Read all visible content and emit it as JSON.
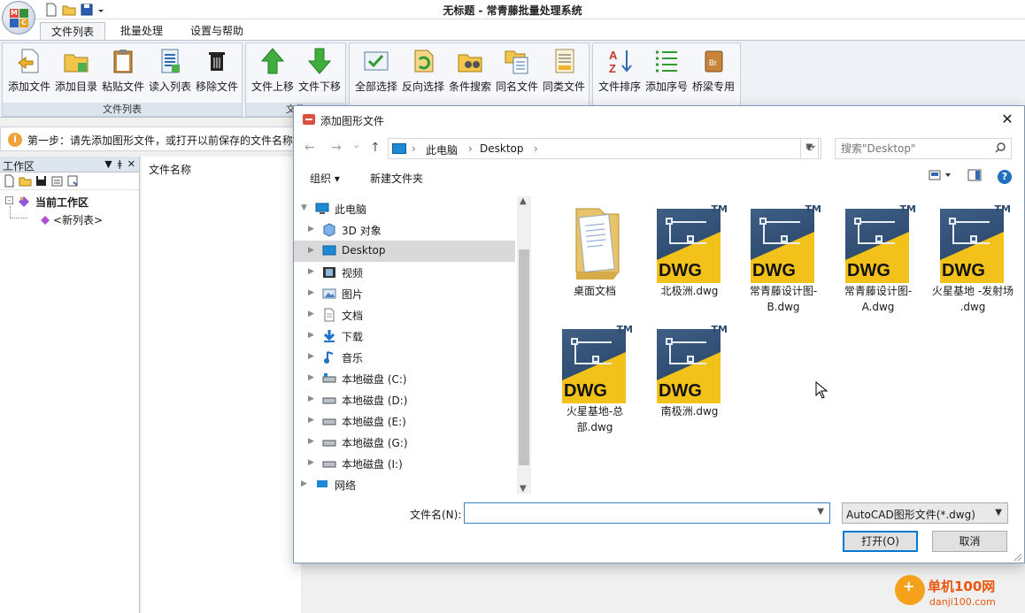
{
  "window": {
    "title": "无标题 - 常青藤批量处理系统",
    "quick_access_icons": [
      "new-file-icon",
      "open-folder-icon",
      "save-icon",
      "dropdown-arrow-icon"
    ]
  },
  "ribbon": {
    "tabs": [
      {
        "label": "文件列表",
        "active": true
      },
      {
        "label": "批量处理",
        "active": false
      },
      {
        "label": "设置与帮助",
        "active": false
      }
    ],
    "groups": [
      {
        "caption": "文件列表",
        "buttons": [
          "添加文件",
          "添加目录",
          "粘贴文件",
          "读入列表",
          "移除文件"
        ]
      },
      {
        "caption": "文件",
        "buttons": [
          "文件上移",
          "文件下移"
        ]
      },
      {
        "caption": "",
        "buttons": [
          "全部选择",
          "反向选择",
          "条件搜索",
          "同名文件",
          "同类文件"
        ]
      },
      {
        "caption": "",
        "buttons": [
          "文件排序",
          "添加序号",
          "桥梁专用"
        ]
      }
    ]
  },
  "hint": {
    "text": "第一步：请先添加图形文件，或打开以前保存的文件名称"
  },
  "workspace": {
    "title": "工作区",
    "controls": [
      "▼",
      "ǂ",
      "✕"
    ],
    "tree": {
      "root": "当前工作区",
      "child": "<新列表>"
    }
  },
  "file_list": {
    "column_header": "文件名称"
  },
  "dialog": {
    "title": "添加图形文件",
    "close": "✕",
    "nav": {
      "back": "←",
      "forward": "→",
      "recent": "⌄",
      "up": "↑"
    },
    "address": {
      "segments": [
        "此电脑",
        "Desktop"
      ],
      "separator": "›"
    },
    "search": {
      "placeholder": "搜索\"Desktop\""
    },
    "commands": {
      "organize": "组织 ▾",
      "new_folder": "新建文件夹"
    },
    "nav_tree": [
      {
        "label": "此电脑",
        "icon": "pc-icon",
        "expanded": true,
        "level": 0,
        "selected": false
      },
      {
        "label": "3D 对象",
        "icon": "3d-objects-icon",
        "level": 1,
        "selected": false
      },
      {
        "label": "Desktop",
        "icon": "desktop-icon",
        "level": 1,
        "selected": true
      },
      {
        "label": "视频",
        "icon": "video-icon",
        "level": 1,
        "selected": false
      },
      {
        "label": "图片",
        "icon": "pictures-icon",
        "level": 1,
        "selected": false
      },
      {
        "label": "文档",
        "icon": "documents-icon",
        "level": 1,
        "selected": false
      },
      {
        "label": "下载",
        "icon": "download-icon",
        "level": 1,
        "selected": false
      },
      {
        "label": "音乐",
        "icon": "music-icon",
        "level": 1,
        "selected": false
      },
      {
        "label": "本地磁盘 (C:)",
        "icon": "drive-icon",
        "level": 1,
        "selected": false
      },
      {
        "label": "本地磁盘 (D:)",
        "icon": "drive-icon",
        "level": 1,
        "selected": false
      },
      {
        "label": "本地磁盘 (E:)",
        "icon": "drive-icon",
        "level": 1,
        "selected": false
      },
      {
        "label": "本地磁盘 (G:)",
        "icon": "drive-icon",
        "level": 1,
        "selected": false
      },
      {
        "label": "本地磁盘 (I:)",
        "icon": "drive-icon",
        "level": 1,
        "selected": false
      },
      {
        "label": "网络",
        "icon": "network-icon",
        "level": 0,
        "selected": false
      }
    ],
    "files": [
      {
        "name": "桌面文档",
        "type": "folder"
      },
      {
        "name": "北极洲.dwg",
        "type": "dwg"
      },
      {
        "name": "常青藤设计图-B.dwg",
        "type": "dwg"
      },
      {
        "name": "常青藤设计图-A.dwg",
        "type": "dwg"
      },
      {
        "name": "火星基地 -发射场 .dwg",
        "type": "dwg"
      },
      {
        "name": "火星基地-总部.dwg",
        "type": "dwg"
      },
      {
        "name": "南极洲.dwg",
        "type": "dwg"
      }
    ],
    "dwg_badge": "DWG",
    "tm_badge": "TM",
    "filename_label": "文件名(N):",
    "filename_value": "",
    "filter_value": "AutoCAD图形文件(*.dwg)",
    "open_button": "打开(O)",
    "cancel_button": "取消"
  },
  "watermark": {
    "brand": "单机100网",
    "url": "danji100.com"
  }
}
